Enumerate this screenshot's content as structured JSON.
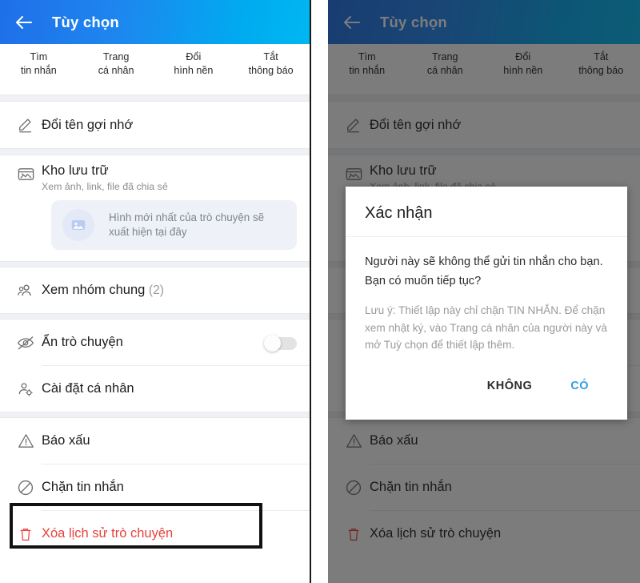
{
  "app": {
    "title": "Tùy chọn",
    "back_icon": "back-arrow-icon"
  },
  "tabs": [
    {
      "line1": "Tìm",
      "line2": "tin nhắn"
    },
    {
      "line1": "Trang",
      "line2": "cá nhân"
    },
    {
      "line1": "Đổi",
      "line2": "hình nền"
    },
    {
      "line1": "Tắt",
      "line2": "thông báo"
    }
  ],
  "menu": {
    "rename": {
      "label": "Đổi tên gợi nhớ",
      "icon": "pencil-icon"
    },
    "archive": {
      "label": "Kho lưu trữ",
      "sub": "Xem ảnh, link, file đã chia sẻ",
      "icon": "photo-folder-icon",
      "preview_text": "Hình mới nhất của trò chuyện sẽ xuất hiện tại đây",
      "preview_icon": "image-placeholder-icon"
    },
    "groups": {
      "label": "Xem nhóm chung",
      "count": "(2)",
      "icon": "people-icon"
    },
    "hide_chat": {
      "label": "Ẩn trò chuyện",
      "icon": "eye-off-icon",
      "toggle_state": "off"
    },
    "personal_settings": {
      "label": "Cài đặt cá nhân",
      "icon": "user-gear-icon"
    },
    "report": {
      "label": "Báo xấu",
      "icon": "warning-triangle-icon"
    },
    "block": {
      "label": "Chặn tin nhắn",
      "icon": "block-circle-icon"
    },
    "delete_history": {
      "label": "Xóa lịch sử trò chuyện",
      "icon": "trash-icon"
    }
  },
  "dialog": {
    "title": "Xác nhận",
    "message": "Người này sẽ không thể gửi tin nhắn cho bạn. Bạn có muốn tiếp tục?",
    "note": "Lưu ý: Thiết lập này chỉ chặn TIN NHẮN. Để chặn xem nhật ký, vào Trang cá nhân của người này và mở Tuỳ chọn để thiết lập thêm.",
    "cancel_label": "KHÔNG",
    "confirm_label": "CÓ"
  },
  "colors": {
    "appbar_from": "#1f6fe8",
    "appbar_to": "#00b7f2",
    "danger": "#e8413c",
    "primary_action": "#2e9fe0",
    "highlight_box": "#111111"
  }
}
